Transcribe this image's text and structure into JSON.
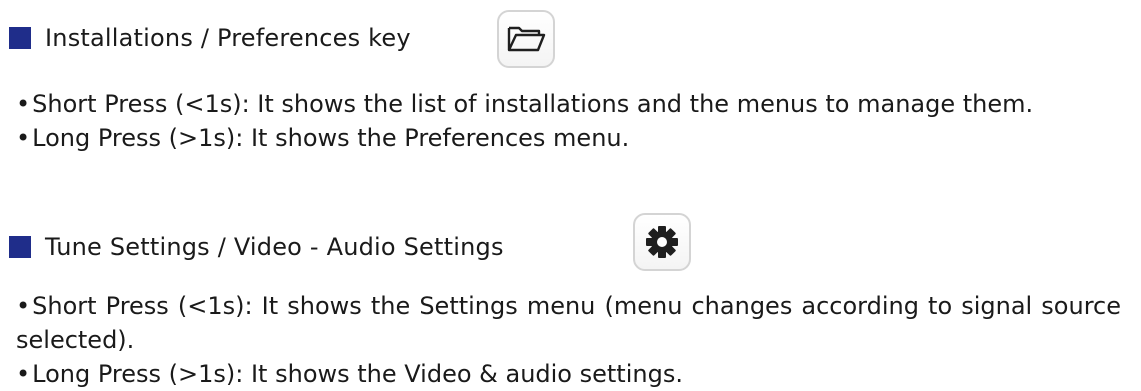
{
  "colors": {
    "square_bullet": "#1f2d8a",
    "text": "#1a1a1a",
    "key_border": "#d4d4d4",
    "icon": "#1f1f1f"
  },
  "sections": [
    {
      "heading": "Installations / Preferences key",
      "icon": "folder-icon",
      "bullets": [
        "Short Press (<1s): It shows the list of installations and the menus to manage them.",
        "Long Press (>1s): It shows the Preferences menu."
      ]
    },
    {
      "heading": "Tune Settings / Video - Audio Settings",
      "icon": "gear-icon",
      "bullets": [
        "Short Press (<1s): It shows the Settings menu (menu changes according to signal source selected).",
        "Long Press (>1s): It shows the Video & audio settings."
      ]
    }
  ]
}
